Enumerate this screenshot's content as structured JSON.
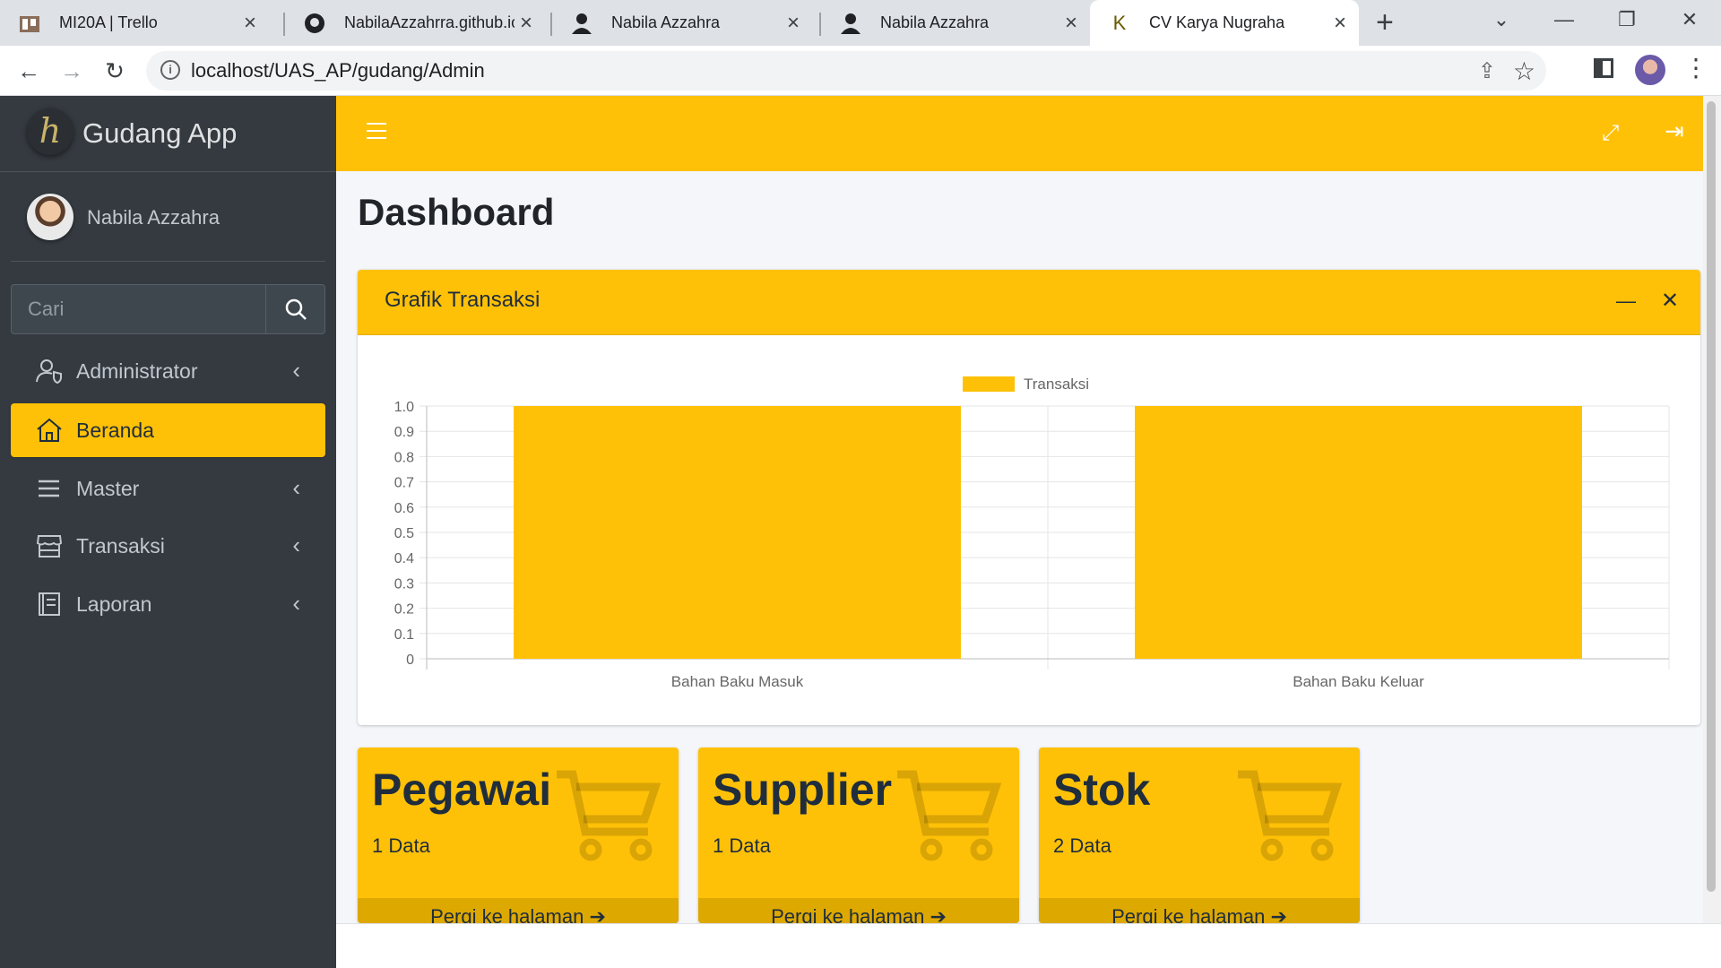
{
  "browser": {
    "tabs": [
      {
        "title": "MI20A | Trello",
        "active": false
      },
      {
        "title": "NabilaAzzahrra.github.io/",
        "active": false
      },
      {
        "title": "Nabila Azzahra",
        "active": false
      },
      {
        "title": "Nabila Azzahra",
        "active": false
      },
      {
        "title": "CV Karya Nugraha",
        "active": true
      }
    ],
    "url": "localhost/UAS_AP/gudang/Admin"
  },
  "sidebar": {
    "brand": "Gudang App",
    "user_name": "Nabila Azzahra",
    "search_placeholder": "Cari",
    "items": [
      {
        "label": "Administrator",
        "icon": "user-shield-icon",
        "active": false,
        "has_submenu": true
      },
      {
        "label": "Beranda",
        "icon": "home-icon",
        "active": true,
        "has_submenu": false
      },
      {
        "label": "Master",
        "icon": "list-icon",
        "active": false,
        "has_submenu": true
      },
      {
        "label": "Transaksi",
        "icon": "store-icon",
        "active": false,
        "has_submenu": true
      },
      {
        "label": "Laporan",
        "icon": "book-icon",
        "active": false,
        "has_submenu": true
      }
    ]
  },
  "main": {
    "title": "Dashboard",
    "card_title": "Grafik Transaksi",
    "accent": "#ffc107"
  },
  "chart_data": {
    "type": "bar",
    "categories": [
      "Bahan Baku Masuk",
      "Bahan Baku Keluar"
    ],
    "series": [
      {
        "name": "Transaksi",
        "values": [
          1,
          1
        ],
        "color": "#ffc107"
      }
    ],
    "ylim": [
      0,
      1.0
    ],
    "yticks": [
      "0",
      "0.1",
      "0.2",
      "0.3",
      "0.4",
      "0.5",
      "0.6",
      "0.7",
      "0.8",
      "0.9",
      "1.0"
    ],
    "legend": "top",
    "grid": true
  },
  "boxes": [
    {
      "title": "Pegawai",
      "count": "1 Data",
      "footer": "Pergi ke halaman"
    },
    {
      "title": "Supplier",
      "count": "1 Data",
      "footer": "Pergi ke halaman"
    },
    {
      "title": "Stok",
      "count": "2 Data",
      "footer": "Pergi ke halaman"
    }
  ]
}
